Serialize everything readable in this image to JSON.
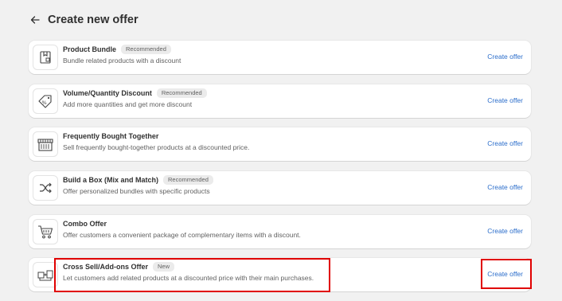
{
  "page": {
    "title": "Create new offer",
    "back_icon": "arrow-left-icon"
  },
  "offers": [
    {
      "title": "Product Bundle",
      "badge": "Recommended",
      "description": "Bundle related products with a discount",
      "action": "Create offer",
      "icon": "product-bundle-icon"
    },
    {
      "title": "Volume/Quantity Discount",
      "badge": "Recommended",
      "description": "Add more quantities and get more discount",
      "action": "Create offer",
      "icon": "percent-tag-icon"
    },
    {
      "title": "Frequently Bought Together",
      "badge": "",
      "description": "Sell frequently bought-together products at a discounted price.",
      "action": "Create offer",
      "icon": "storefront-icon"
    },
    {
      "title": "Build a Box (Mix and Match)",
      "badge": "Recommended",
      "description": "Offer personalized bundles with specific products",
      "action": "Create offer",
      "icon": "shuffle-icon"
    },
    {
      "title": "Combo Offer",
      "badge": "",
      "description": "Offer customers a convenient package of complementary items with a discount.",
      "action": "Create offer",
      "icon": "cart-icon"
    },
    {
      "title": "Cross Sell/Add-ons Offer",
      "badge": "New",
      "description": "Let customers add related products at a discounted price with their main purchases.",
      "action": "Create offer",
      "icon": "cross-sell-icon"
    }
  ],
  "colors": {
    "background": "#f1f1f1",
    "card": "#ffffff",
    "link": "#2c6ecb",
    "highlight": "#e00000"
  }
}
